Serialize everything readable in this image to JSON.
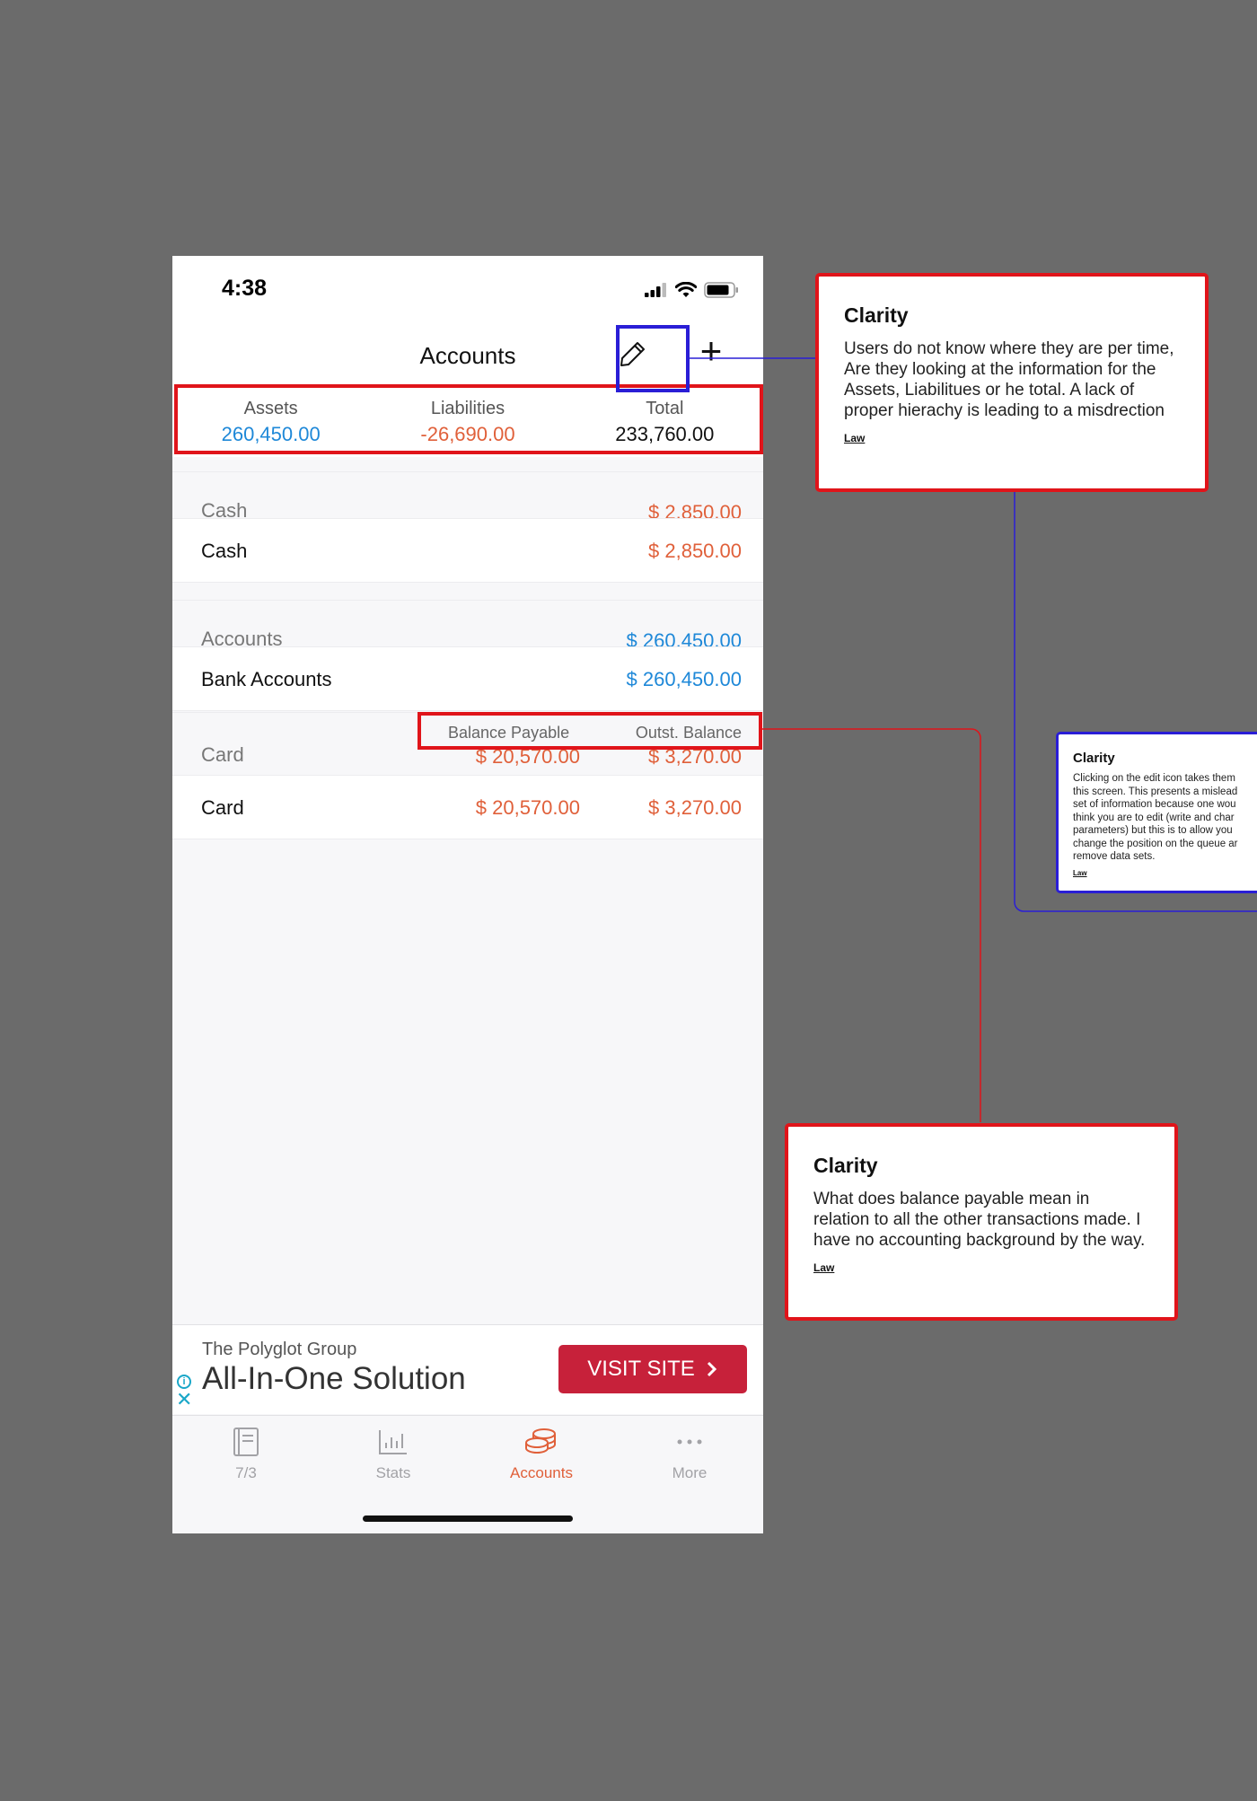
{
  "status_bar": {
    "time": "4:38"
  },
  "nav": {
    "title": "Accounts",
    "add_label": "+"
  },
  "summary": [
    {
      "label": "Assets",
      "value": "260,450.00",
      "color": "#1e88d8"
    },
    {
      "label": "Liabilities",
      "value": "-26,690.00",
      "color": "#e0603a"
    },
    {
      "label": "Total",
      "value": "233,760.00",
      "color": "#111111"
    }
  ],
  "groups": {
    "cash": {
      "header": "Cash",
      "header_value": "$ 2,850.00",
      "row_label": "Cash",
      "row_value": "$ 2,850.00"
    },
    "accounts": {
      "header": "Accounts",
      "header_value": "$ 260,450.00",
      "row_label": "Bank Accounts",
      "row_value": "$ 260,450.00"
    },
    "card": {
      "col_balance_payable": "Balance Payable",
      "col_outst_balance": "Outst. Balance",
      "header": "Card",
      "header_payable": "$ 20,570.00",
      "header_outst": "$ 3,270.00",
      "row_label": "Card",
      "row_payable": "$ 20,570.00",
      "row_outst": "$ 3,270.00"
    }
  },
  "ad": {
    "brand": "The Polyglot Group",
    "headline": "All-In-One Solution",
    "button": "VISIT SITE",
    "info_icon": "i",
    "close_icon": "✕"
  },
  "tabs": [
    {
      "label": "7/3",
      "icon": "book-icon",
      "active": false
    },
    {
      "label": "Stats",
      "icon": "bar-chart-icon",
      "active": false
    },
    {
      "label": "Accounts",
      "icon": "coins-stack-icon",
      "active": true
    },
    {
      "label": "More",
      "icon": "more-dots-icon",
      "active": false
    }
  ],
  "annotations": [
    {
      "title": "Clarity",
      "body": "Users do not know where they are per time, Are they looking at the information for the Assets, Liabilitues or he total. A lack of proper hierachy is leading to a misdrection",
      "link": "Law",
      "border_color": "#e0141a"
    },
    {
      "title": "Clarity",
      "body_lines": [
        "Clicking on the edit icon takes them",
        "this screen. This presents a mislead",
        "set of information because one wou",
        "think you are to edit (write and char",
        "parameters) but this is to allow you",
        "change the position on the queue ar",
        "remove data sets."
      ],
      "link": "Law",
      "border_color": "#2a1ed6"
    },
    {
      "title": "Clarity",
      "body": "What does balance payable mean in relation to all the other transactions made. I have no accounting background by the way.",
      "link": "Law",
      "border_color": "#e0141a"
    }
  ],
  "colors": {
    "background": "#6b6b6b",
    "accent_blue": "#1e88d8",
    "accent_red": "#e0603a",
    "annotation_red": "#e0141a",
    "annotation_blue": "#2a1ed6",
    "ad_button": "#c7213a"
  }
}
